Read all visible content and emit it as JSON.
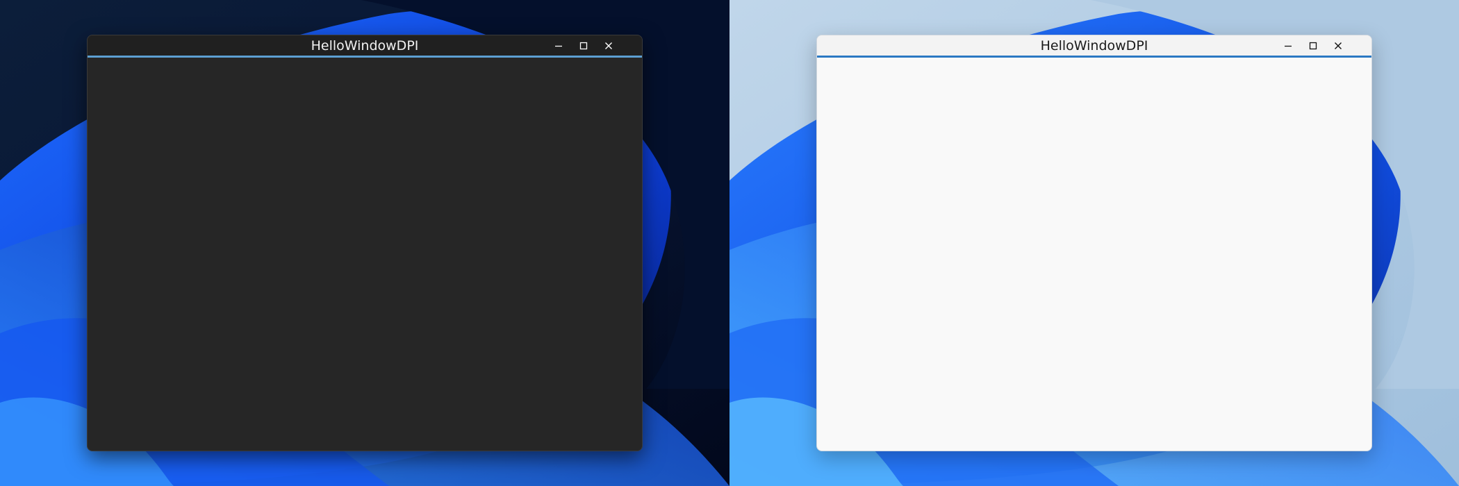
{
  "desktops": [
    {
      "theme": "dark",
      "window": {
        "title": "HelloWindowDPI",
        "accent_color": "#5c9fd2",
        "client_color": "#262626"
      }
    },
    {
      "theme": "light",
      "window": {
        "title": "HelloWindowDPI",
        "accent_color": "#2b78c3",
        "client_color": "#f9f9f9"
      }
    }
  ],
  "icons": {
    "minimize": "minimize-icon",
    "maximize": "maximize-icon",
    "close": "close-icon"
  }
}
